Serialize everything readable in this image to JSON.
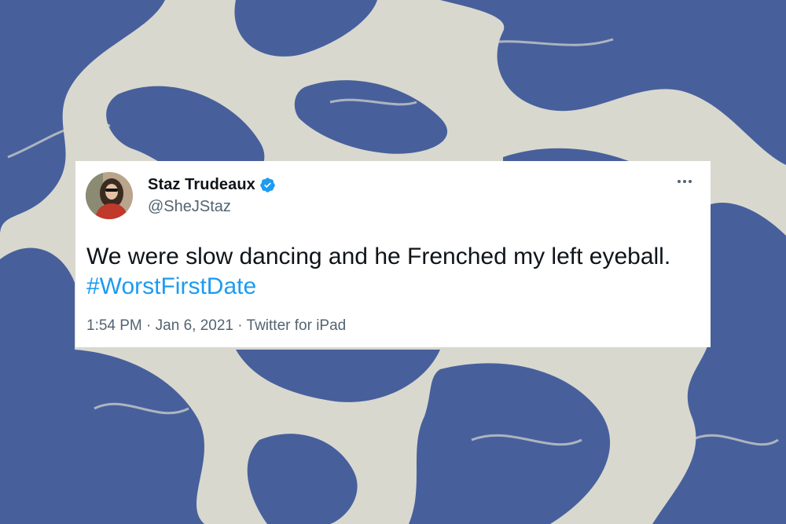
{
  "tweet": {
    "author_name": "Staz Trudeaux",
    "author_handle": "@SheJStaz",
    "text": "We were slow dancing and he Frenched my left eyeball.",
    "hashtag": "#WorstFirstDate",
    "time": "1:54 PM",
    "separator": "·",
    "date": "Jan 6, 2021",
    "source": "Twitter for iPad"
  },
  "colors": {
    "background_light": "#d9d8cf",
    "background_swirl": "#47609c",
    "hashtag": "#1d9bf0",
    "verified": "#1d9bf0"
  },
  "icons": {
    "verified": "verified-badge-icon",
    "more": "more-options-icon"
  }
}
